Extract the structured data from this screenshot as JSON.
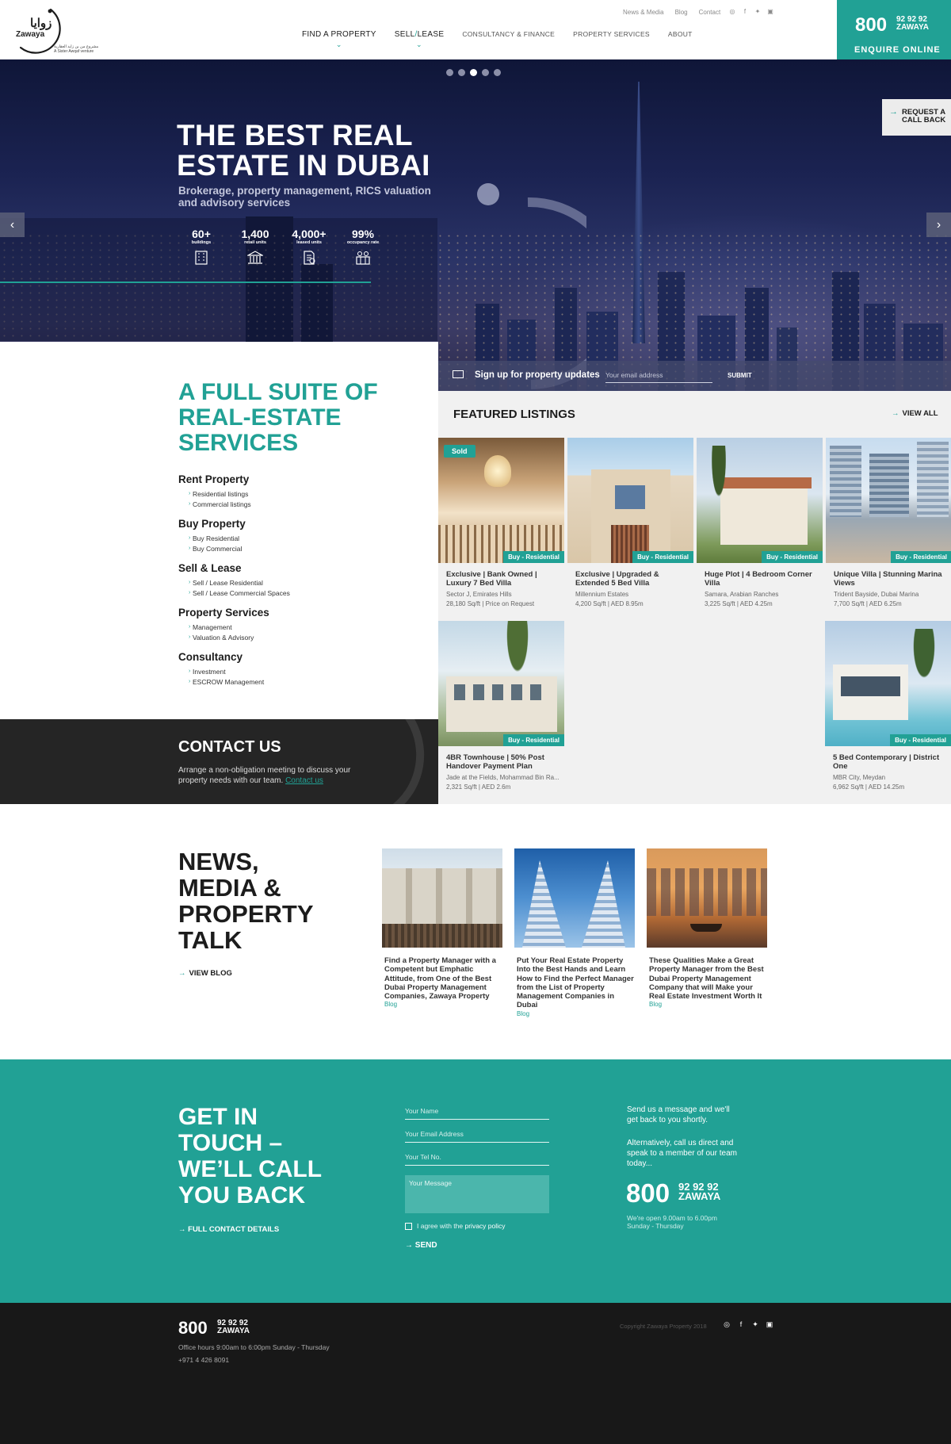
{
  "brand": {
    "arabic": "زوايا",
    "name": "Zawaya",
    "venture": "مشروع من بن زايد العقارية A Sister Awqaf venture"
  },
  "top_links": [
    "News & Media",
    "Blog",
    "Contact"
  ],
  "social_icons": [
    "instagram-icon",
    "facebook-icon",
    "twitter-icon",
    "youtube-icon"
  ],
  "nav": {
    "find": "FIND A PROPERTY",
    "sell": "SELL",
    "lease": "LEASE",
    "consultancy": "CONSULTANCY & FINANCE",
    "services": "PROPERTY SERVICES",
    "about": "ABOUT"
  },
  "cta": {
    "number": "800",
    "number_small_1": "92 92 92",
    "number_small_2": "ZAWAYA",
    "enquire": "ENQUIRE ONLINE"
  },
  "hero": {
    "title": "THE BEST REAL ESTATE IN DUBAI",
    "subtitle": "Brokerage, property management, RICS valuation and advisory services",
    "stats": [
      {
        "value": "60+",
        "label": "buildings"
      },
      {
        "value": "1,400",
        "label": "retail units"
      },
      {
        "value": "4,000+",
        "label": "leased units"
      },
      {
        "value": "99%",
        "label": "occupancy rate"
      }
    ],
    "slide_count": 5,
    "active_slide": 3,
    "callback": "REQUEST A CALL BACK"
  },
  "signup": {
    "label": "Sign up for property updates",
    "placeholder": "Your email address",
    "submit": "SUBMIT"
  },
  "services": {
    "title": "A FULL SUITE OF REAL-ESTATE SERVICES",
    "groups": [
      {
        "title": "Rent Property",
        "items": [
          "Residential listings",
          "Commercial listings"
        ]
      },
      {
        "title": "Buy Property",
        "items": [
          "Buy Residential",
          "Buy Commercial"
        ]
      },
      {
        "title": "Sell & Lease",
        "items": [
          "Sell / Lease Residential",
          "Sell / Lease Commercial Spaces"
        ]
      },
      {
        "title": "Property Services",
        "items": [
          "Management",
          "Valuation & Advisory"
        ]
      },
      {
        "title": "Consultancy",
        "items": [
          "Investment",
          "ESCROW Management"
        ]
      }
    ]
  },
  "contact": {
    "title": "CONTACT US",
    "text": "Arrange a non-obligation meeting to discuss your property needs with our team.",
    "link": "Contact us"
  },
  "listings": {
    "title": "FEATURED LISTINGS",
    "view_all": "VIEW ALL",
    "sold_label": "Sold",
    "cards": [
      {
        "title": "Exclusive | Bank Owned | Luxury 7 Bed Villa",
        "location": "Sector J, Emirates Hills",
        "meta": "28,180 Sq/ft | Price on Request",
        "badge": "Buy - Residential"
      },
      {
        "title": "Exclusive | Upgraded & Extended 5 Bed Villa",
        "location": "Millennium Estates",
        "meta": "4,200 Sq/ft | AED 8.95m",
        "badge": "Buy - Residential"
      },
      {
        "title": "Huge Plot | 4 Bedroom Corner Villa",
        "location": "Samara, Arabian Ranches",
        "meta": "3,225 Sq/ft | AED 4.25m",
        "badge": "Buy - Residential"
      },
      {
        "title": "Unique Villa | Stunning Marina Views",
        "location": "Trident Bayside, Dubai Marina",
        "meta": "7,700 Sq/ft | AED 6.25m",
        "badge": "Buy - Residential"
      },
      {
        "title": "4BR Townhouse | 50% Post Handover Payment Plan",
        "location": "Jade at the Fields, Mohammad Bin Ra...",
        "meta": "2,321 Sq/ft | AED 2.6m",
        "badge": "Buy - Residential"
      },
      {
        "title": "5 Bed Contemporary | District One",
        "location": "MBR City, Meydan",
        "meta": "6,962 Sq/ft | AED 14.25m",
        "badge": "Buy - Residential"
      }
    ]
  },
  "news": {
    "title": "NEWS, MEDIA & PROPERTY TALK",
    "view_blog": "VIEW BLOG",
    "articles": [
      {
        "title": "Find a Property Manager with a Competent but Emphatic Attitude, from One of the Best Dubai Property Management Companies, Zawaya Property",
        "tag": "Blog"
      },
      {
        "title": "Put Your Real Estate Property Into the Best Hands and Learn How to Find the Perfect Manager from the List of Property Management Companies in Dubai",
        "tag": "Blog"
      },
      {
        "title": "These Qualities Make a Great Property Manager from the Best Dubai Property Management Company that will Make your Real Estate Investment Worth It",
        "tag": "Blog"
      }
    ]
  },
  "touch": {
    "title": "GET IN TOUCH – WE’LL CALL YOU BACK",
    "full_details": "FULL CONTACT DETAILS",
    "name_ph": "Your Name",
    "email_ph": "Your Email Address",
    "tel_ph": "Your Tel No.",
    "msg_ph": "Your Message",
    "agree": "I agree with the",
    "privacy": "privacy policy",
    "send": "SEND",
    "info1": "Send us a message and we'll get back to you shortly.",
    "info2": "Alternatively, call us direct and speak to a member of our team today...",
    "number": "800",
    "number_small_1": "92 92 92",
    "number_small_2": "ZAWAYA",
    "hours1": "We're open 9.00am to 6.00pm",
    "hours2": "Sunday - Thursday"
  },
  "footer": {
    "number": "800",
    "number_small_1": "92 92 92",
    "number_small_2": "ZAWAYA",
    "hours": "Office hours 9:00am to 6:00pm Sunday - Thursday",
    "phone": "+971 4 426 8091",
    "copyright": "Copyright Zawaya Property 2018"
  },
  "colors": {
    "accent": "#21a195",
    "dark": "#252525",
    "footer": "#181818"
  }
}
